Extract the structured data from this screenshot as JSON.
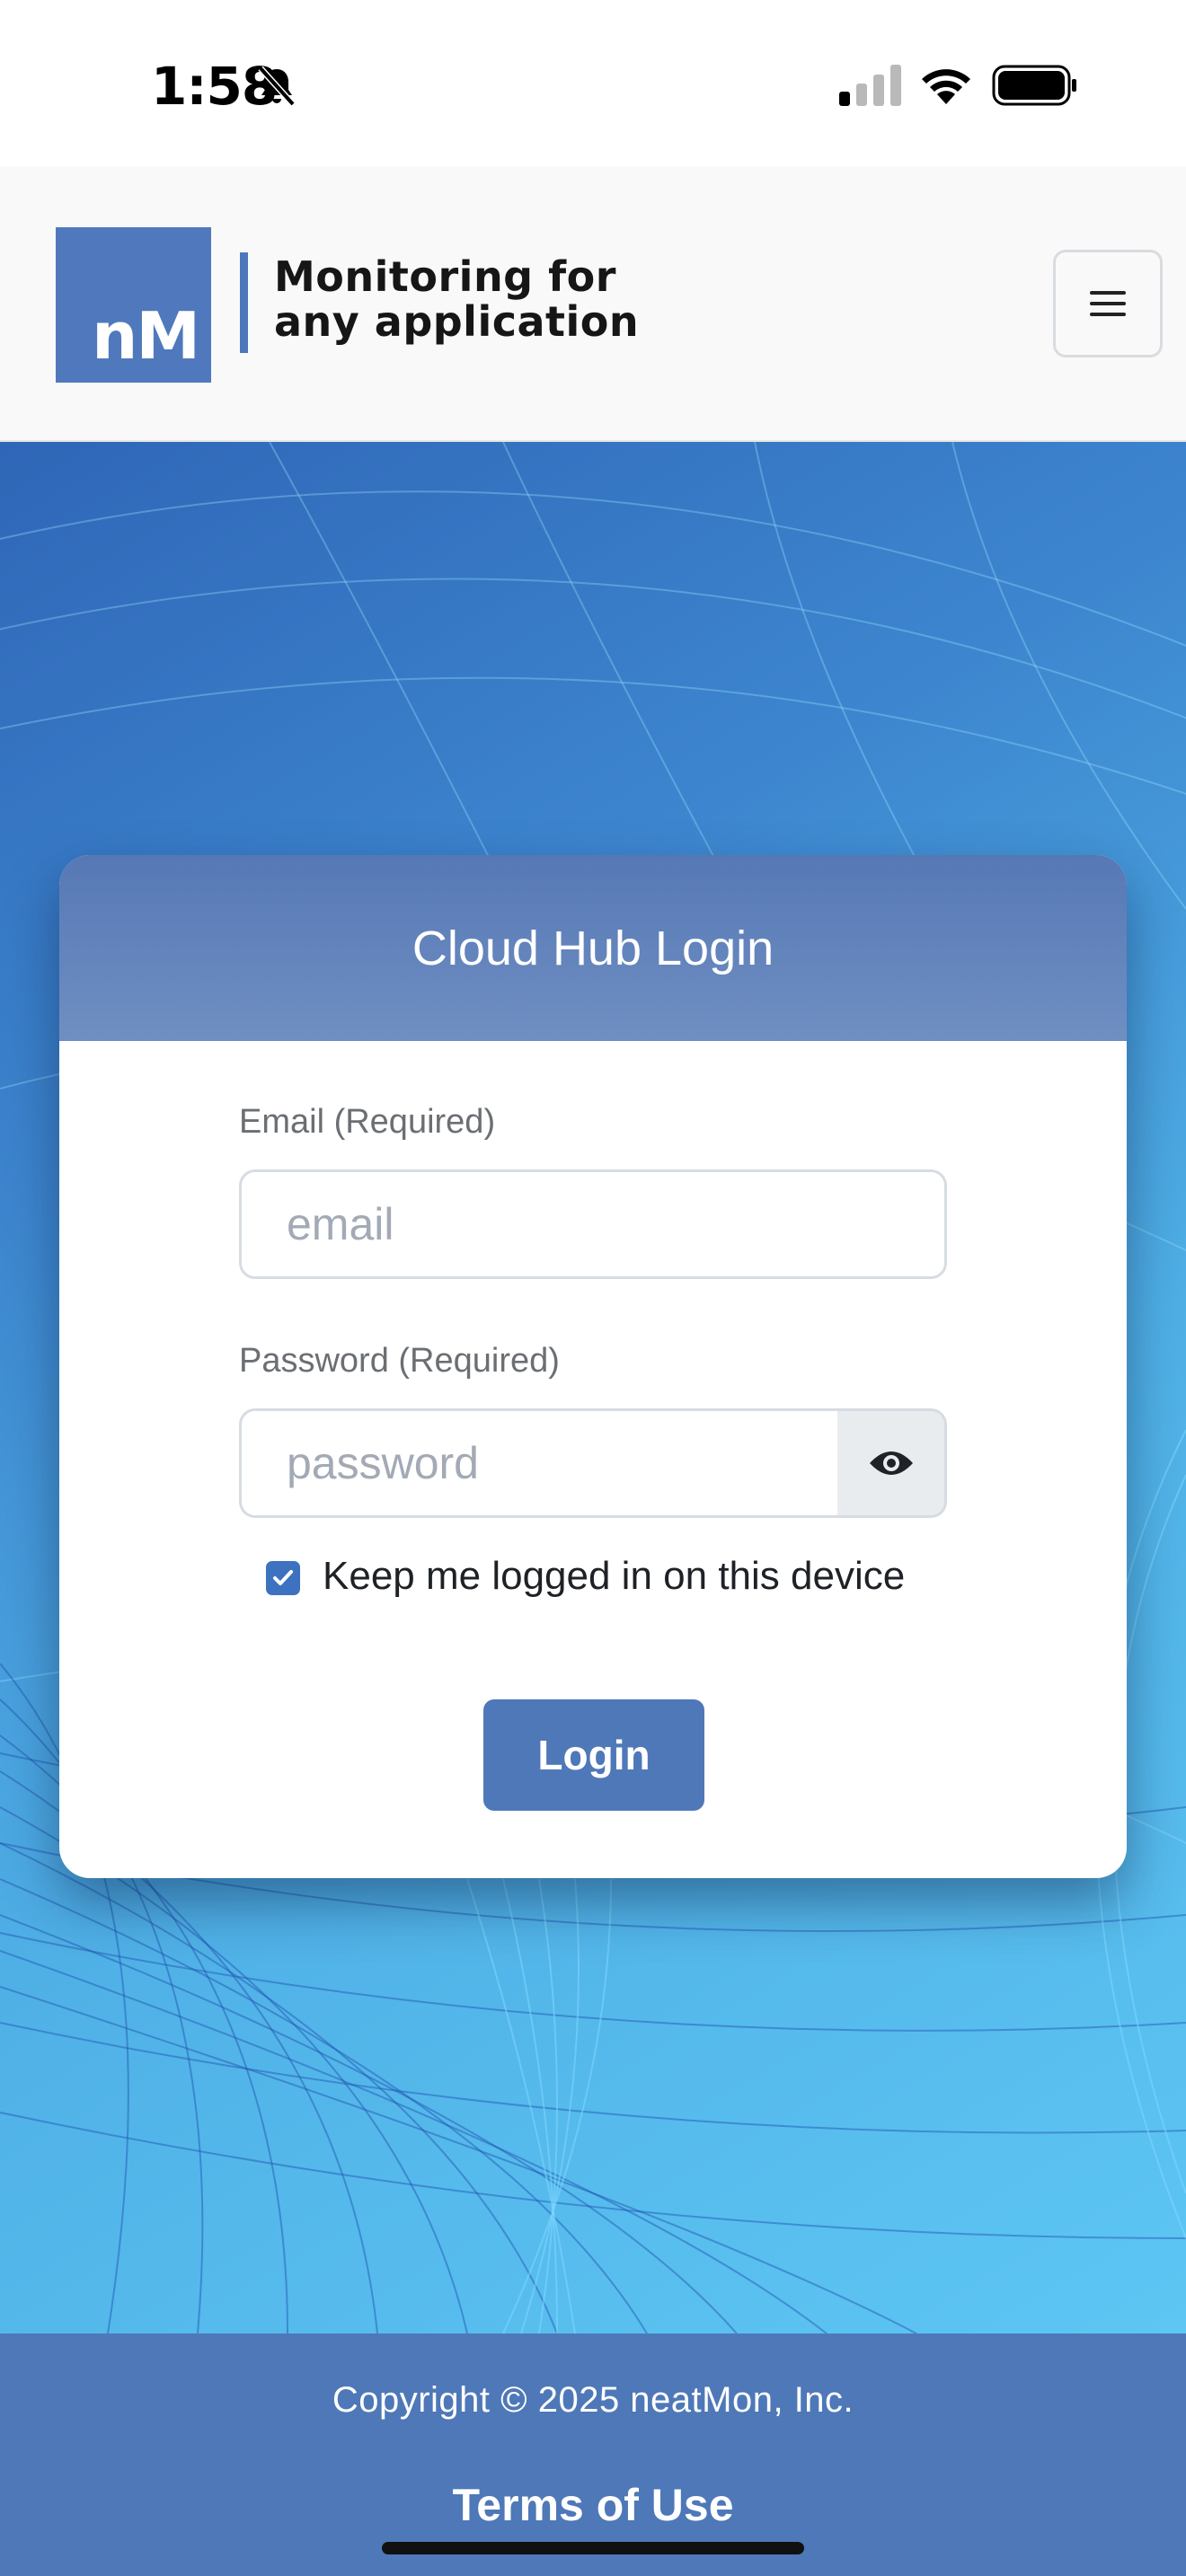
{
  "status_bar": {
    "time": "1:58",
    "icons": [
      "bell-slash-icon",
      "cellular-signal-icon",
      "wifi-icon",
      "battery-icon"
    ]
  },
  "header": {
    "logo_mark": "nM",
    "tagline_line1": "Monitoring for",
    "tagline_line2": "any application",
    "menu_icon": "hamburger-menu-icon"
  },
  "login": {
    "title": "Cloud Hub Login",
    "email_label": "Email (Required)",
    "email_placeholder": "email",
    "email_value": "",
    "password_label": "Password (Required)",
    "password_placeholder": "password",
    "password_value": "",
    "show_password_icon": "eye-icon",
    "remember_label": "Keep me logged in on this device",
    "remember_checked": true,
    "submit_label": "Login"
  },
  "footer": {
    "copyright": "Copyright © 2025 neatMon, Inc.",
    "terms_label": "Terms of Use"
  },
  "colors": {
    "brand": "#5079bd",
    "card_header": "#6080bb",
    "footer": "#4e78b8",
    "checkbox": "#3d72c1"
  }
}
